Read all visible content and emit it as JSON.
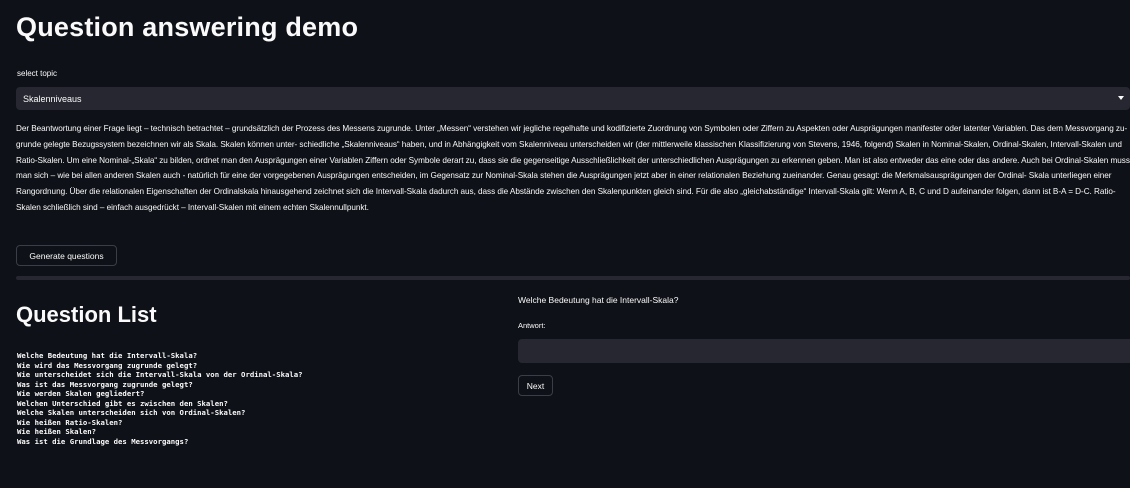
{
  "title": "Question answering demo",
  "select": {
    "label": "select topic",
    "value": "Skalenniveaus"
  },
  "paragraph": "Der Beantwortung einer Frage liegt – technisch betrachtet – grundsätzlich der Prozess des Messens zugrunde. Unter „Messen“ verstehen wir jegliche regelhafte und kodifizierte Zuordnung von Symbolen oder Ziffern zu Aspekten oder Ausprägungen manifester oder latenter Variablen. Das dem Messvorgang zu- grunde gelegte Bezugssystem bezeichnen wir als Skala. Skalen können unter- schiedliche „Skalenniveaus“ haben, und in Abhängigkeit vom Skalenniveau unterscheiden wir (der mittlerweile klassischen Klassifizierung von Stevens, 1946, folgend) Skalen in Nominal-Skalen, Ordinal-Skalen, Intervall-Skalen und Ratio-Skalen. Um eine Nominal-„Skala“ zu bilden, ordnet man den Ausprägungen einer Variablen Ziffern oder Symbole derart zu, dass sie die gegenseitige Ausschließlichkeit der unterschiedlichen Ausprägungen zu erkennen geben. Man ist also entweder das eine oder das andere. Auch bei Ordinal-Skalen muss man sich – wie bei allen anderen Skalen auch - natürlich für eine der vorgegebenen Ausprägungen entscheiden, im Gegensatz zur Nominal-Skala stehen die Ausprägungen jetzt aber in einer relationalen Beziehung zueinander. Genau gesagt: die Merkmalsausprägungen der Ordinal- Skala unterliegen einer Rangordnung. Über die relationalen Eigenschaften der Ordinalskala hinausgehend zeichnet sich die Intervall-Skala dadurch aus, dass die Abstände zwischen den Skalenpunkten gleich sind. Für die also „gleichabständige“ Intervall-Skala gilt: Wenn A, B, C und D aufeinander folgen, dann ist B-A = D-C. Ratio-Skalen schließlich sind – einfach ausgedrückt – Intervall-Skalen mit einem echten Skalennullpunkt.",
  "generate_button": "Generate questions",
  "question_list": {
    "title": "Question List",
    "items": [
      "Welche Bedeutung hat die Intervall-Skala?",
      "Wie wird das Messvorgang zugrunde gelegt?",
      "Wie unterscheidet sich die Intervall-Skala von der Ordinal-Skala?",
      "Was ist das Messvorgang zugrunde gelegt?",
      "Wie werden Skalen gegliedert?",
      "Welchen Unterschied gibt es zwischen den Skalen?",
      "Welche Skalen unterscheiden sich von Ordinal-Skalen?",
      "Wie heißen Ratio-Skalen?",
      "Wie heißen Skalen?",
      "Was ist die Grundlage des Messvorgangs?"
    ]
  },
  "answer_panel": {
    "question": "Welche Bedeutung hat die Intervall-Skala?",
    "answer_label": "Antwort:",
    "answer_value": "",
    "next_button": "Next"
  },
  "colors": {
    "background": "#0e1117",
    "widget": "#262730",
    "text": "#fafafa"
  }
}
